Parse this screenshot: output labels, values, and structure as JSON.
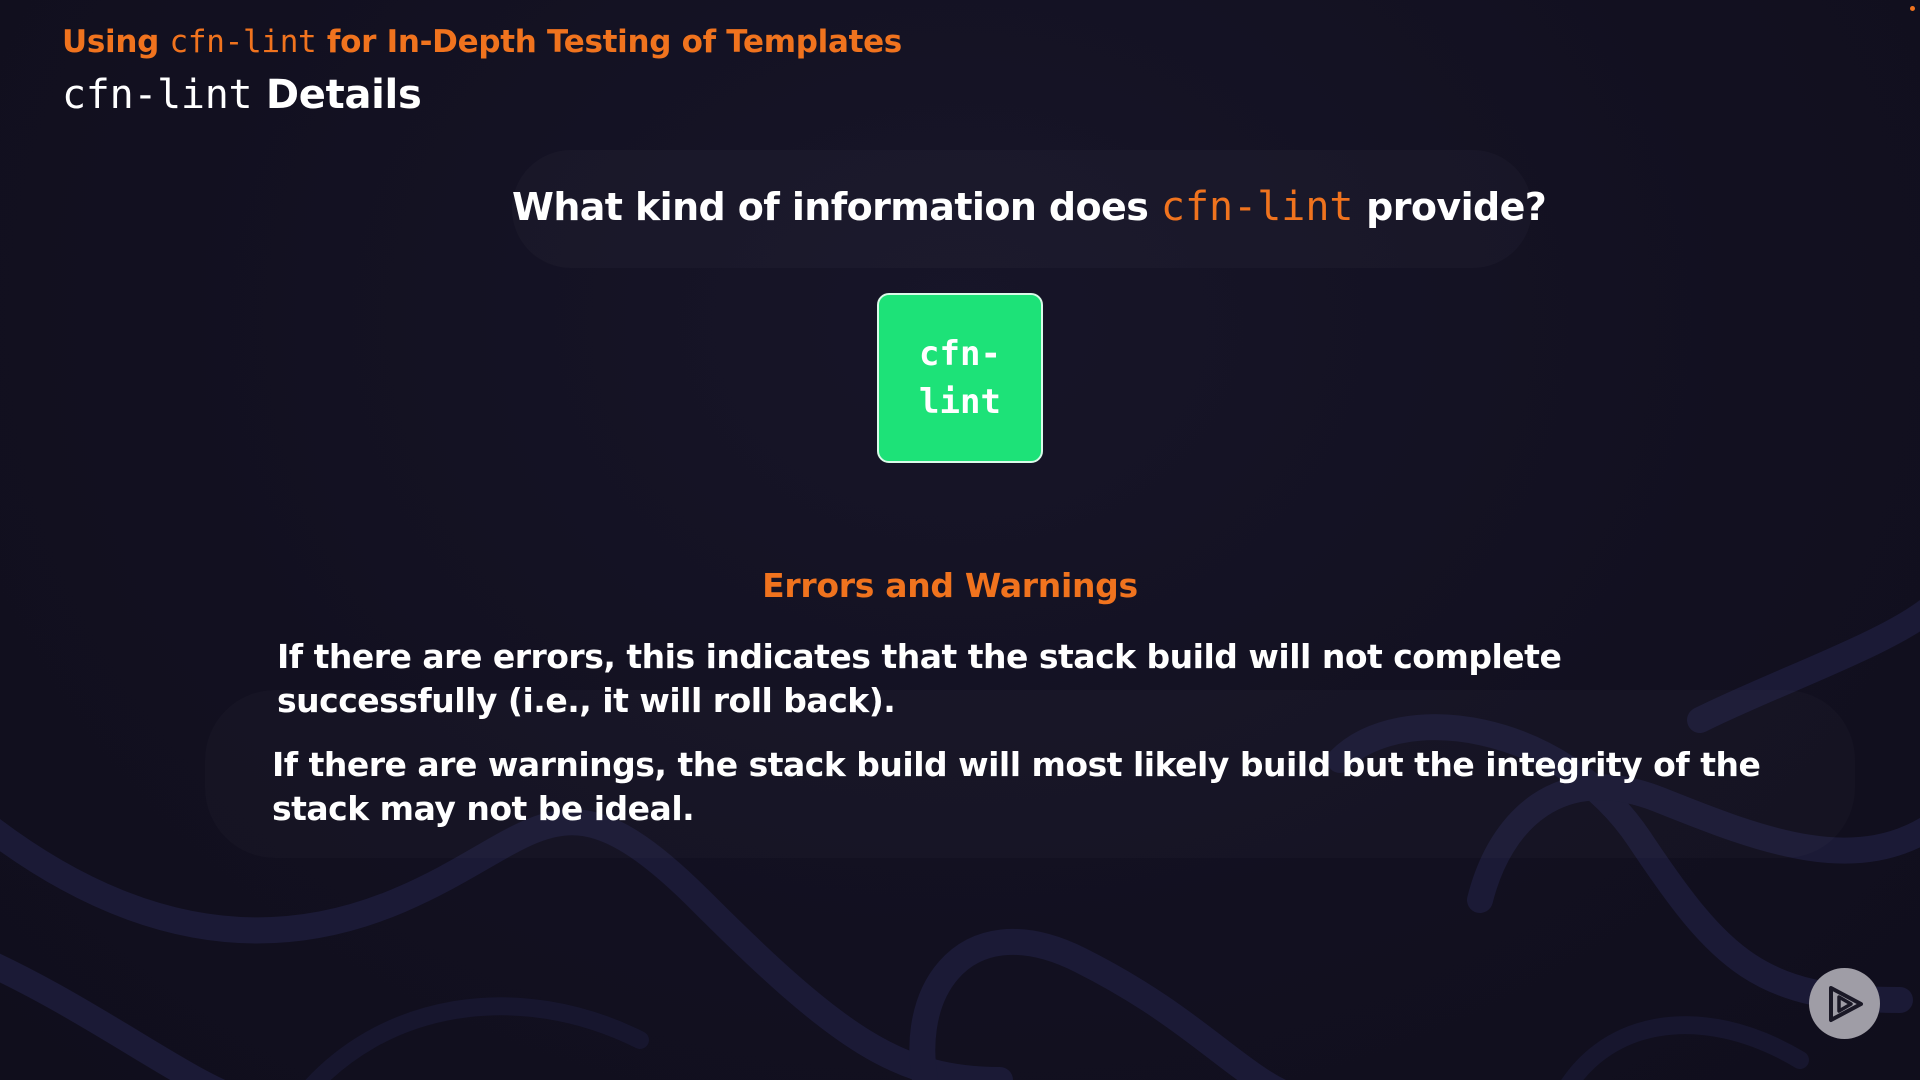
{
  "header": {
    "kicker_prefix": "Using ",
    "kicker_code": "cfn-lint",
    "kicker_suffix": " for In-Depth Testing of Templates",
    "title_code": "cfn-lint",
    "title_suffix": " Details"
  },
  "question": {
    "prefix": "What kind of information does ",
    "code": "cfn-lint",
    "suffix": " provide?"
  },
  "tool_box": {
    "label": "cfn-lint"
  },
  "section": {
    "heading": "Errors and Warnings",
    "errors_text": "If there are errors, this indicates that the stack build will not complete successfully (i.e., it will roll back).",
    "warnings_text": "If there are warnings, the stack build will most likely build but the integrity of the stack may not be ideal."
  },
  "icons": {
    "player": "play-icon"
  },
  "colors": {
    "background": "#13111f",
    "accent": "#f0731e",
    "tool_green": "#1de278",
    "text": "#ffffff"
  }
}
